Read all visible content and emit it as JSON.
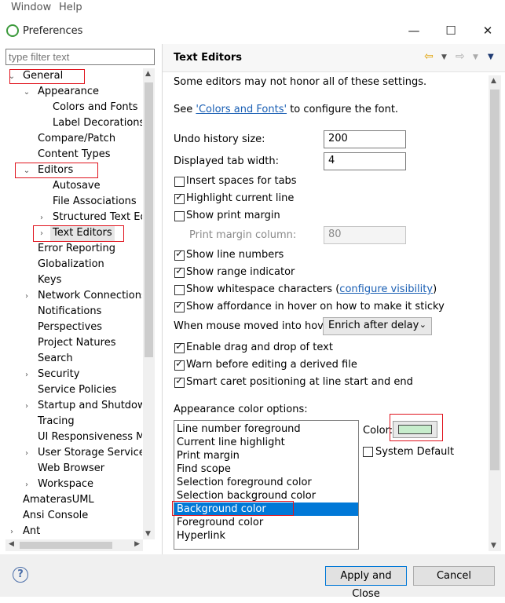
{
  "menubar": {
    "window": "Window",
    "help": "Help"
  },
  "window": {
    "title": "Preferences",
    "minimize": "—",
    "maximize": "☐",
    "close": "✕"
  },
  "filter": {
    "placeholder": "type filter text"
  },
  "tree": [
    {
      "label": "General",
      "indent": 0,
      "twisty": "⌄",
      "boxed": true
    },
    {
      "label": "Appearance",
      "indent": 1,
      "twisty": "⌄"
    },
    {
      "label": "Colors and Fonts",
      "indent": 2,
      "twisty": ""
    },
    {
      "label": "Label Decorations",
      "indent": 2,
      "twisty": ""
    },
    {
      "label": "Compare/Patch",
      "indent": 1,
      "twisty": ""
    },
    {
      "label": "Content Types",
      "indent": 1,
      "twisty": ""
    },
    {
      "label": "Editors",
      "indent": 1,
      "twisty": "⌄",
      "boxed": true
    },
    {
      "label": "Autosave",
      "indent": 2,
      "twisty": ""
    },
    {
      "label": "File Associations",
      "indent": 2,
      "twisty": ""
    },
    {
      "label": "Structured Text Edi",
      "indent": 2,
      "twisty": "›"
    },
    {
      "label": "Text Editors",
      "indent": 2,
      "twisty": "›",
      "boxed": true,
      "selected": true
    },
    {
      "label": "Error Reporting",
      "indent": 1,
      "twisty": ""
    },
    {
      "label": "Globalization",
      "indent": 1,
      "twisty": ""
    },
    {
      "label": "Keys",
      "indent": 1,
      "twisty": ""
    },
    {
      "label": "Network Connections",
      "indent": 1,
      "twisty": "›"
    },
    {
      "label": "Notifications",
      "indent": 1,
      "twisty": ""
    },
    {
      "label": "Perspectives",
      "indent": 1,
      "twisty": ""
    },
    {
      "label": "Project Natures",
      "indent": 1,
      "twisty": ""
    },
    {
      "label": "Search",
      "indent": 1,
      "twisty": ""
    },
    {
      "label": "Security",
      "indent": 1,
      "twisty": "›"
    },
    {
      "label": "Service Policies",
      "indent": 1,
      "twisty": ""
    },
    {
      "label": "Startup and Shutdown",
      "indent": 1,
      "twisty": "›"
    },
    {
      "label": "Tracing",
      "indent": 1,
      "twisty": ""
    },
    {
      "label": "UI Responsiveness Mo",
      "indent": 1,
      "twisty": ""
    },
    {
      "label": "User Storage Service",
      "indent": 1,
      "twisty": "›"
    },
    {
      "label": "Web Browser",
      "indent": 1,
      "twisty": ""
    },
    {
      "label": "Workspace",
      "indent": 1,
      "twisty": "›"
    },
    {
      "label": "AmaterasUML",
      "indent": 0,
      "twisty": ""
    },
    {
      "label": "Ansi Console",
      "indent": 0,
      "twisty": ""
    },
    {
      "label": "Ant",
      "indent": 0,
      "twisty": "›"
    }
  ],
  "page": {
    "title": "Text Editors",
    "note": "Some editors may not honor all of these settings.",
    "see_prefix": "See ",
    "see_link": "'Colors and Fonts'",
    "see_suffix": " to configure the font.",
    "undo_label": "Undo history size:",
    "undo_value": "200",
    "tab_label": "Displayed tab width:",
    "tab_value": "4",
    "checkboxes": [
      {
        "label": "Insert spaces for tabs",
        "checked": false
      },
      {
        "label": "Highlight current line",
        "checked": true
      },
      {
        "label": "Show print margin",
        "checked": false
      }
    ],
    "print_margin_label": "Print margin column:",
    "print_margin_value": "80",
    "checkboxes2": [
      {
        "label": "Show line numbers",
        "checked": true
      },
      {
        "label": "Show range indicator",
        "checked": true
      },
      {
        "label": "Show whitespace characters (",
        "checked": false
      },
      {
        "label": "Show affordance in hover on how to make it sticky",
        "checked": true
      }
    ],
    "configure_visibility": "configure visibility",
    "close_paren": ")",
    "hover_label": "When mouse moved into hover:",
    "hover_value": "Enrich after delay",
    "checkboxes3": [
      {
        "label": "Enable drag and drop of text",
        "checked": true
      },
      {
        "label": "Warn before editing a derived file",
        "checked": true
      },
      {
        "label": "Smart caret positioning at line start and end",
        "checked": true
      }
    ],
    "appearance_label": "Appearance color options:",
    "color_options": [
      "Line number foreground",
      "Current line highlight",
      "Print margin",
      "Find scope",
      "Selection foreground color",
      "Selection background color",
      "Background color",
      "Foreground color",
      "Hyperlink"
    ],
    "selected_option": "Background color",
    "color_label": "Color:",
    "swatch_color": "#c7edcc",
    "system_default": "System Default"
  },
  "buttons": {
    "help": "?",
    "apply_close": "Apply and Close",
    "cancel": "Cancel"
  },
  "colors": {
    "highlight_box": "#e0141e",
    "selection": "#0078d7"
  }
}
